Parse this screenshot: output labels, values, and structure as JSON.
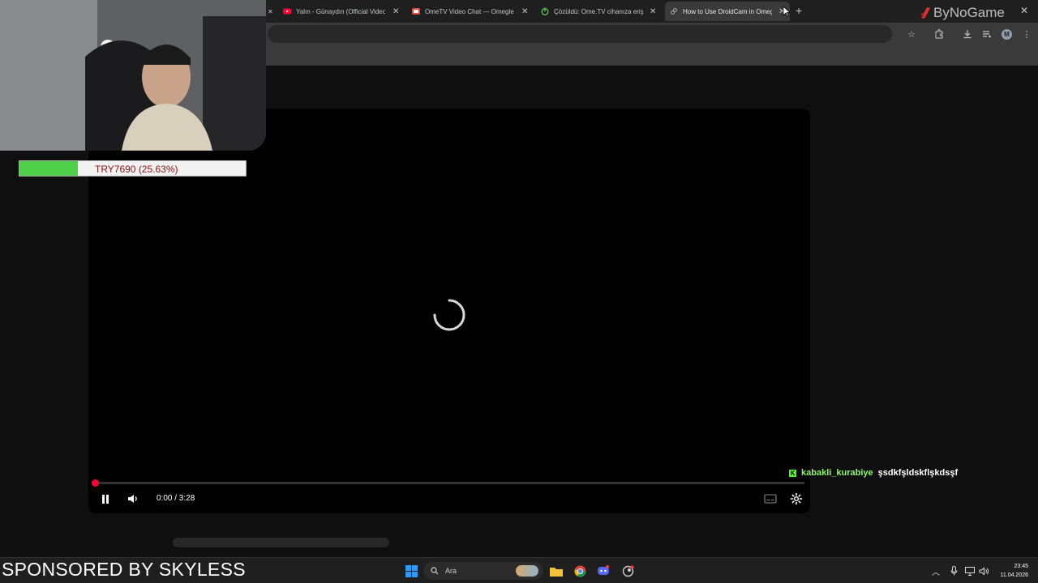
{
  "browser": {
    "tabs": [
      {
        "title": "Yalın - Günaydın (Official Video)",
        "favicon": "youtube-icon",
        "active": false
      },
      {
        "title": "OmeTV Video Chat — Omegle",
        "favicon": "ometv-icon",
        "active": false
      },
      {
        "title": "Çözüldü: Ome.TV cihanıza erişim",
        "favicon": "power-icon",
        "active": false
      },
      {
        "title": "How to Use DroidCam in Omegle",
        "favicon": "link-icon",
        "active": true
      }
    ],
    "toolbar_icons": [
      "star-icon",
      "extensions-icon",
      "download-icon",
      "media-control-icon"
    ],
    "profile_initial": "M"
  },
  "player": {
    "current_time": "0:00",
    "duration": "3:28",
    "time_display": "0:00 / 3:28",
    "state": "loading",
    "progress_fraction": 0.0
  },
  "overlay": {
    "donation_goal": {
      "text": "TRY7690 (25.63%)",
      "progress_fraction": 0.2563
    },
    "chat": {
      "username": "kabakli_kurabiye",
      "message": "şsdkfşldskflşkdsşf"
    },
    "watermark": "ByNoGame",
    "sponsor": "SPONSORED BY SKYLESS"
  },
  "taskbar": {
    "search_label": "Ara",
    "time": "23:45",
    "date": "11.04.2026",
    "colors": {
      "start": "#0078d4",
      "progress_green": "#4fd24a",
      "accent_red": "#ff0033"
    }
  }
}
